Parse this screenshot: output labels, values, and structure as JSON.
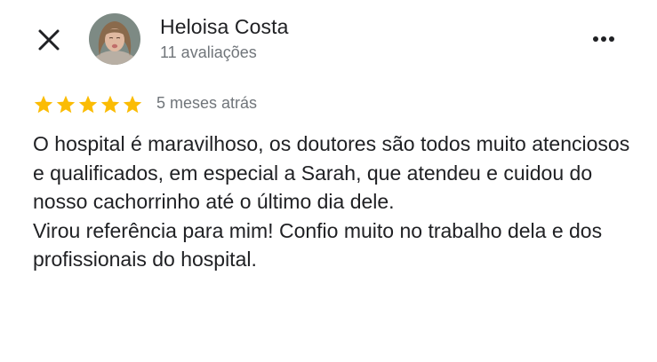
{
  "colors": {
    "text_primary": "#202124",
    "text_secondary": "#70757a",
    "star": "#fbbc04"
  },
  "header": {
    "close_icon": "close-icon",
    "more_icon": "more-horizontal-icon"
  },
  "author": {
    "name": "Heloisa Costa",
    "reviews_count": "11 avaliações"
  },
  "review": {
    "rating": 5,
    "rating_max": 5,
    "date": "5 meses atrás",
    "paragraphs": [
      "O hospital é maravilhoso, os doutores são todos muito atenciosos e qualificados, em especial a Sarah, que atendeu e cuidou do nosso cachorrinho até o último dia dele.",
      "Virou referência para mim! Confio muito no trabalho dela e dos profissionais do hospital."
    ]
  }
}
